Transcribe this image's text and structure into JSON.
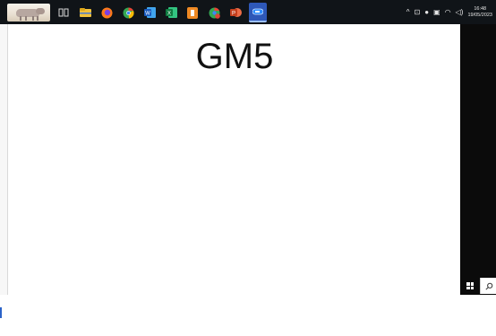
{
  "taskbar": {
    "apps": [
      {
        "name": "task-view",
        "icon": "task-view-icon",
        "color": "#dcdcdc"
      },
      {
        "name": "file-explorer",
        "icon": "folder-icon",
        "color": "#f3c13a"
      },
      {
        "name": "firefox",
        "icon": "firefox-icon",
        "color": "#ff7a1a"
      },
      {
        "name": "chrome",
        "icon": "chrome-icon",
        "color": "#34a853"
      },
      {
        "name": "word",
        "icon": "word-icon",
        "color": "#2b579a"
      },
      {
        "name": "excel",
        "icon": "excel-icon",
        "color": "#217346"
      },
      {
        "name": "app-orange",
        "icon": "orange-app-icon",
        "color": "#f08a24"
      },
      {
        "name": "chrome-profile",
        "icon": "chrome-profile-icon",
        "color": "#db4437"
      },
      {
        "name": "powerpoint",
        "icon": "powerpoint-icon",
        "color": "#d24726"
      },
      {
        "name": "zoom",
        "icon": "zoom-icon",
        "color": "#2d8cff"
      }
    ],
    "tray": {
      "chevron": "^",
      "time": "16:48",
      "date": "19/05/2023"
    }
  },
  "slide": {
    "title": "GM5"
  },
  "colors": {
    "taskbar_bg": "#101418",
    "side_strip": "#0b0b0b",
    "active_app": "#2e58b8"
  }
}
